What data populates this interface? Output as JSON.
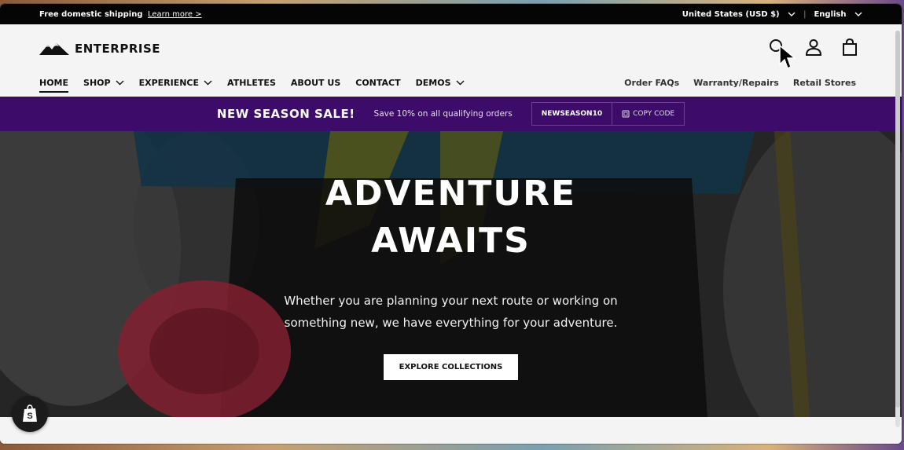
{
  "announcement": {
    "text": "Free domestic shipping",
    "link": "Learn more >",
    "currency": "United States (USD $)",
    "language": "English"
  },
  "brand": {
    "name": "ENTERPRISE"
  },
  "nav": {
    "items": [
      {
        "label": "HOME",
        "active": true,
        "dropdown": false
      },
      {
        "label": "SHOP",
        "dropdown": true
      },
      {
        "label": "EXPERIENCE",
        "dropdown": true
      },
      {
        "label": "ATHLETES",
        "dropdown": false
      },
      {
        "label": "ABOUT US",
        "dropdown": false
      },
      {
        "label": "CONTACT",
        "dropdown": false
      },
      {
        "label": "DEMOS",
        "dropdown": true
      }
    ],
    "secondary": [
      "Order FAQs",
      "Warranty/Repairs",
      "Retail Stores"
    ]
  },
  "promo": {
    "headline": "NEW SEASON SALE!",
    "sub": "Save 10% on all qualifying orders",
    "code": "NEWSEASON10",
    "copy_label": "COPY CODE",
    "bg_color": "#3d0c6b"
  },
  "hero": {
    "title_line1": "ADVENTURE",
    "title_line2": "AWAITS",
    "text_line1": "Whether you are planning your next route or working on",
    "text_line2": "something new, we have everything for your adventure.",
    "button": "EXPLORE COLLECTIONS"
  },
  "icons": [
    "search-icon",
    "account-icon",
    "cart-bag-icon",
    "shopify-icon"
  ]
}
